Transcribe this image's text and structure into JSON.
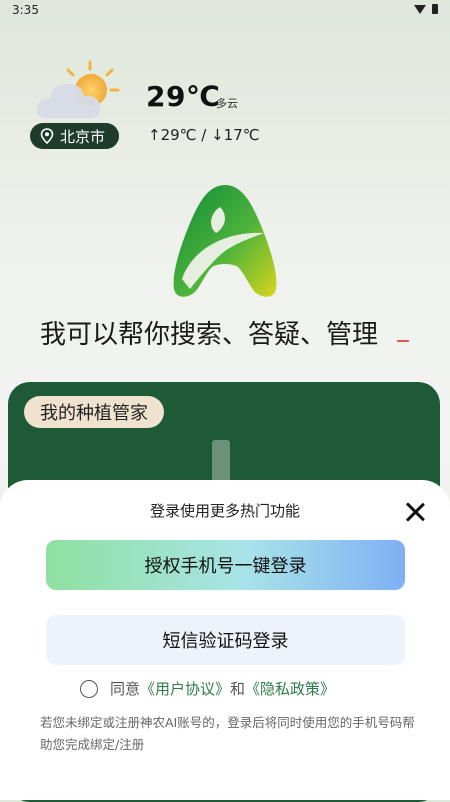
{
  "status_bar": {
    "time": "3:35"
  },
  "weather": {
    "location": "北京市",
    "temperature": "29℃",
    "condition": "多云",
    "range": "↑29℃ / ↓17℃"
  },
  "tagline": "我可以帮你搜索、答疑、管理",
  "card": {
    "chip_label": "我的种植管家"
  },
  "login_sheet": {
    "title": "登录使用更多热门功能",
    "primary_button": "授权手机号一键登录",
    "secondary_button": "短信验证码登录",
    "agree_prefix": "同意",
    "user_agreement": "《用户协议》",
    "and": "和",
    "privacy_policy": "《隐私政策》",
    "note": "若您未绑定或注册神农AI账号的，登录后将同时使用您的手机号码帮助您完成绑定/注册"
  },
  "colors": {
    "brand_green": "#1f5a37",
    "link_green": "#2f7a4c",
    "location_pill": "#1f3b2c"
  },
  "icons": [
    "wifi-icon",
    "battery-icon",
    "partly-cloudy-icon",
    "location-pin-icon",
    "app-logo",
    "close-icon"
  ]
}
